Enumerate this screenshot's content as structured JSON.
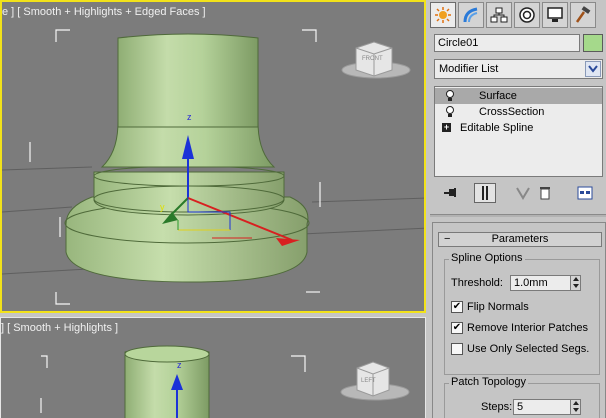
{
  "viewports": {
    "top_label": "e ] [ Smooth + Highlights + Edged Faces ]",
    "bottom_label": "] [ Smooth + Highlights ]",
    "top_viewcube": "FRONT",
    "bottom_viewcube": "LEFT",
    "axis_z": "z",
    "axis_y": "y",
    "axis_z_bottom": "z"
  },
  "command_panel": {
    "tabs": [
      {
        "icon": "create-sun-icon",
        "active": true
      },
      {
        "icon": "modify-bend-icon",
        "active": false
      },
      {
        "icon": "hierarchy-icon",
        "active": false
      },
      {
        "icon": "motion-icon",
        "active": false
      },
      {
        "icon": "display-monitor-icon",
        "active": false
      },
      {
        "icon": "utilities-hammer-icon",
        "active": false
      }
    ],
    "object_name": "Circle01",
    "object_color": "#a5d98b",
    "modifier_list": "Modifier List",
    "stack": {
      "items": [
        {
          "label": "Surface",
          "selected": true
        },
        {
          "label": "CrossSection",
          "selected": false
        },
        {
          "label": "Editable Spline",
          "selected": false
        }
      ]
    },
    "parameters": {
      "title": "Parameters",
      "collapse_symbol": "−",
      "spline_options": {
        "title": "Spline Options",
        "threshold_label": "Threshold:",
        "threshold_value": "1.0mm",
        "flip_normals_label": "Flip Normals",
        "flip_normals": true,
        "remove_patches_label": "Remove Interior Patches",
        "remove_patches": true,
        "use_selected_label": "Use Only Selected Segs.",
        "use_selected": false
      },
      "patch_topology": {
        "title": "Patch Topology",
        "steps_label": "Steps:",
        "steps_value": "5"
      }
    }
  },
  "colors": {
    "viewport_bg": "#7c7c7c",
    "active_border": "#f2e21a",
    "object_green": "#b9d79b",
    "panel_bg": "#c5c5c5"
  }
}
